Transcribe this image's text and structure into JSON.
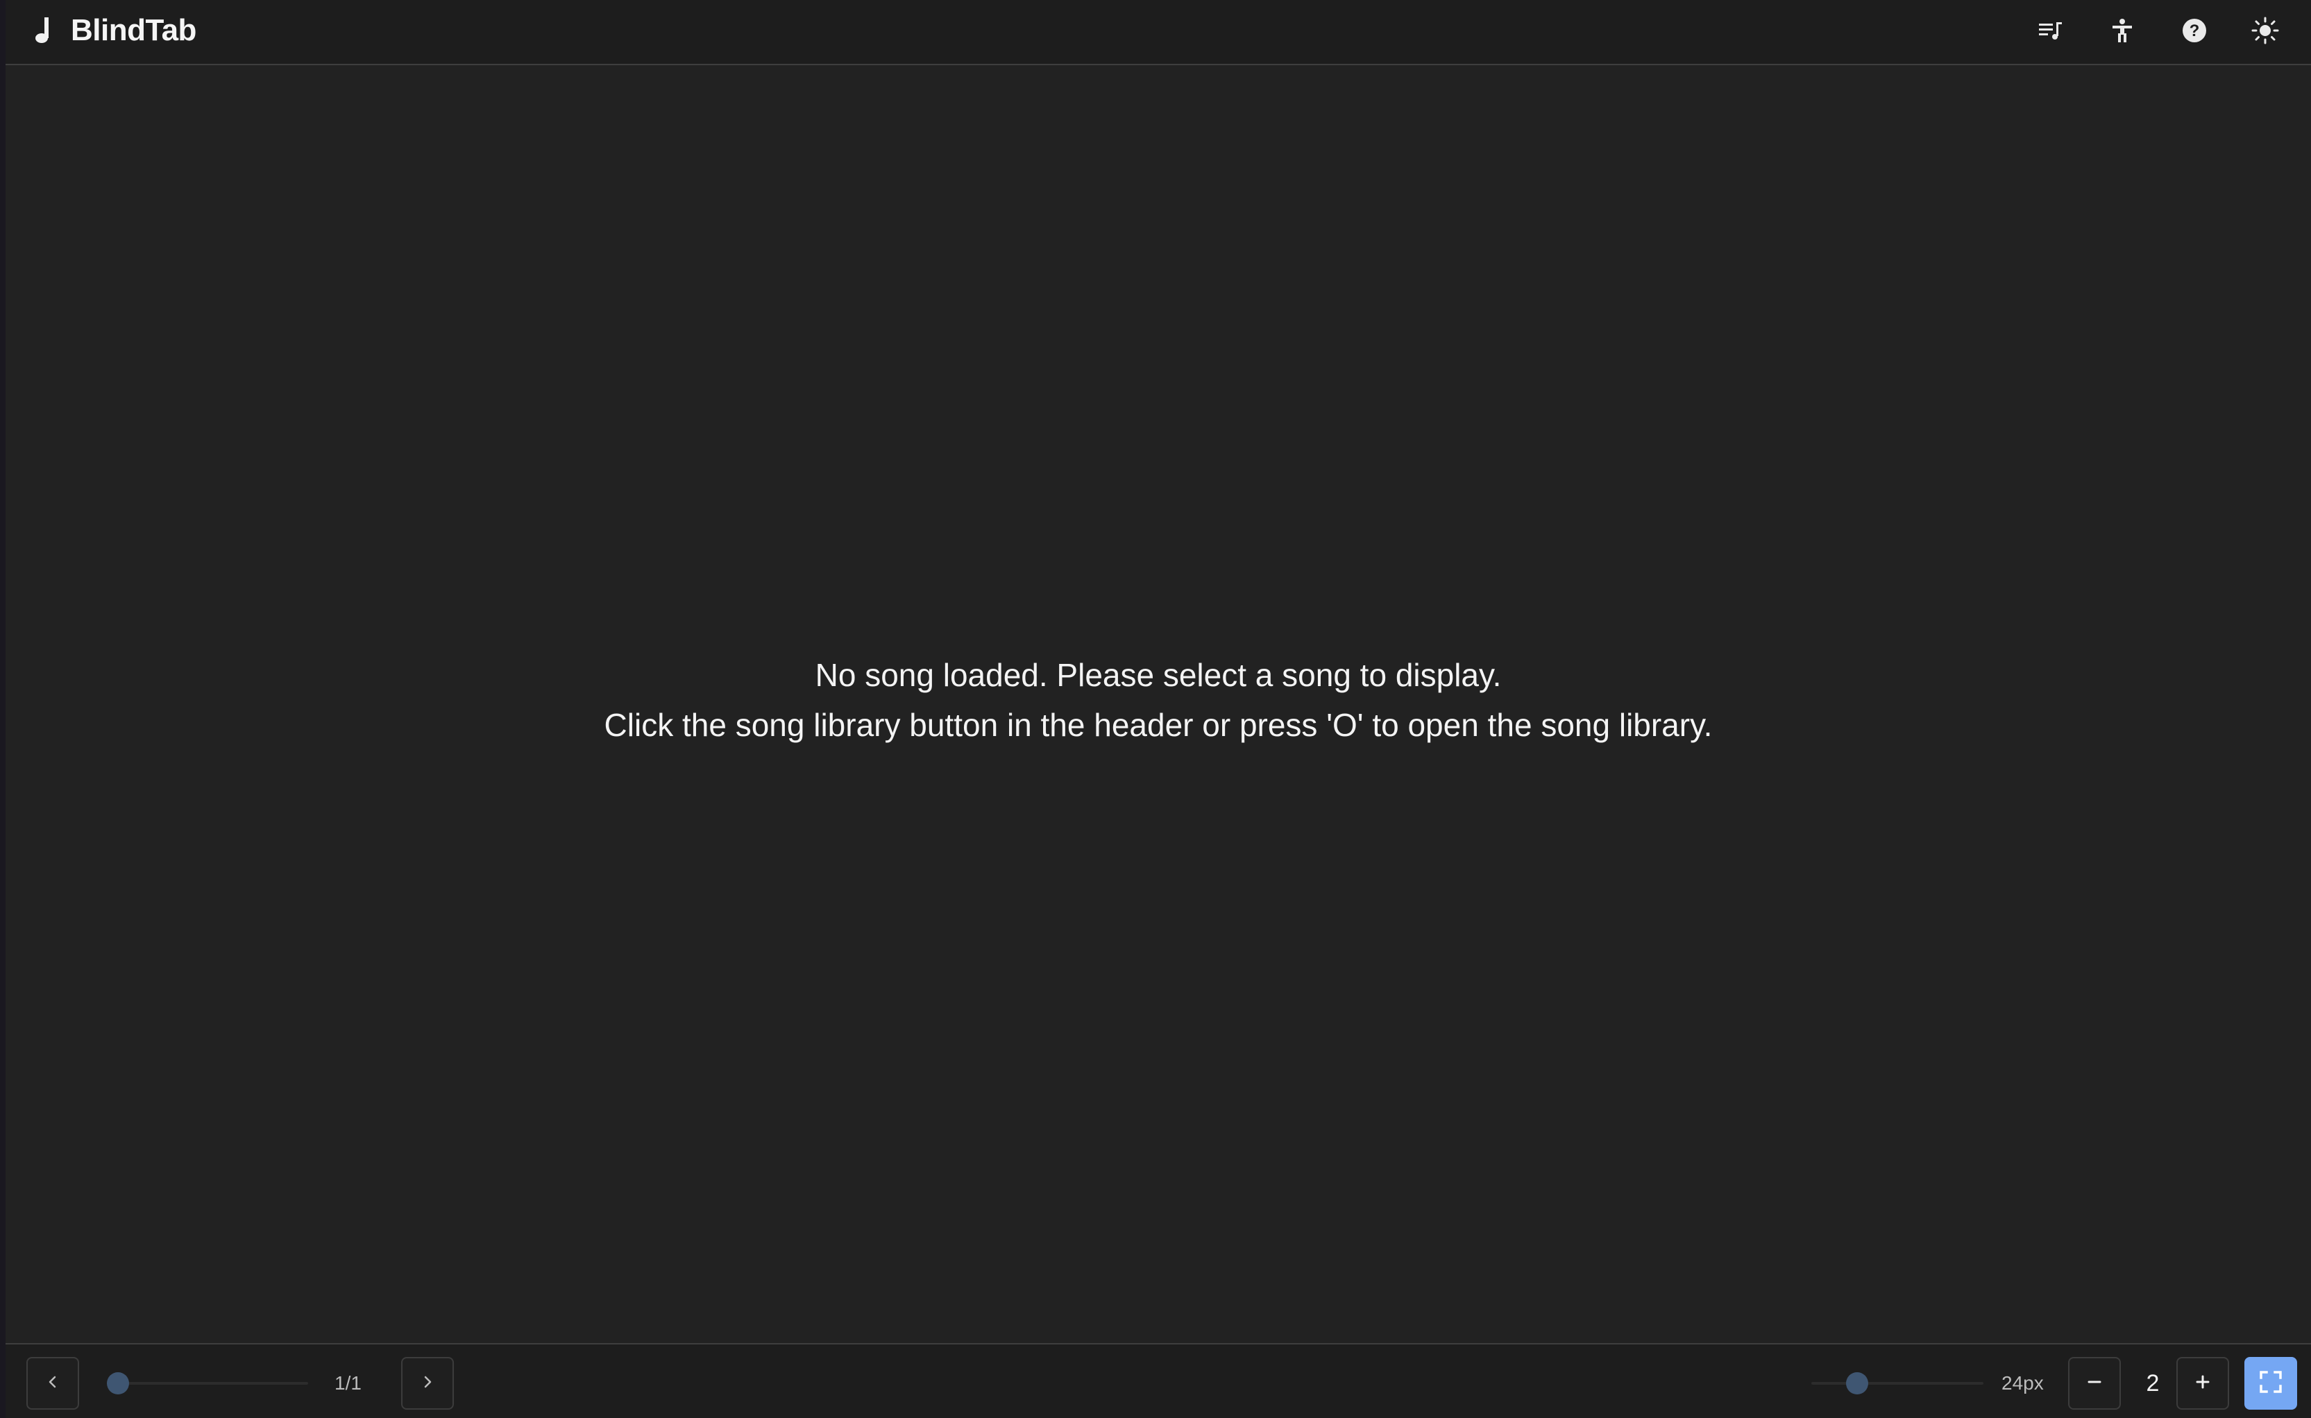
{
  "header": {
    "app_title": "BlindTab",
    "icons": [
      "music-note-icon",
      "song-library-icon",
      "accessibility-icon",
      "help-icon",
      "theme-toggle-icon"
    ]
  },
  "main": {
    "message_line1": "No song loaded. Please select a song to display.",
    "message_line2": "Click the song library button in the header or press 'O' to open the song library."
  },
  "footer": {
    "page_indicator": "1/1",
    "page_slider_fraction": 0.0,
    "font_size_label": "24px",
    "font_slider_fraction": 0.23,
    "column_count": "2",
    "icons": [
      "chevron-left-icon",
      "chevron-right-icon",
      "minus-icon",
      "plus-icon",
      "fullscreen-icon"
    ]
  },
  "colors": {
    "background": "#222222",
    "header_bg": "#1d1d1d",
    "text": "#f2f2f2",
    "slider_thumb": "#3f5672",
    "accent": "#75a7f3"
  }
}
